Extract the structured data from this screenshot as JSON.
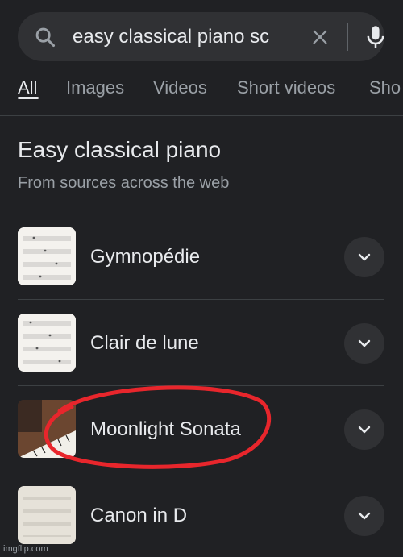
{
  "search": {
    "query": "easy classical piano sc"
  },
  "tabs": [
    {
      "label": "All"
    },
    {
      "label": "Images"
    },
    {
      "label": "Videos"
    },
    {
      "label": "Short videos"
    },
    {
      "label": "Sho"
    }
  ],
  "section": {
    "title": "Easy classical piano",
    "subtitle": "From sources across the web"
  },
  "results": [
    {
      "label": "Gymnopédie",
      "thumb": "sheet-music"
    },
    {
      "label": "Clair de lune",
      "thumb": "sheet-music"
    },
    {
      "label": "Moonlight Sonata",
      "thumb": "piano-photo"
    },
    {
      "label": "Canon in D",
      "thumb": "sheet-music"
    }
  ],
  "annotation": {
    "color": "#e8262c"
  },
  "watermark": "imgflip.com"
}
